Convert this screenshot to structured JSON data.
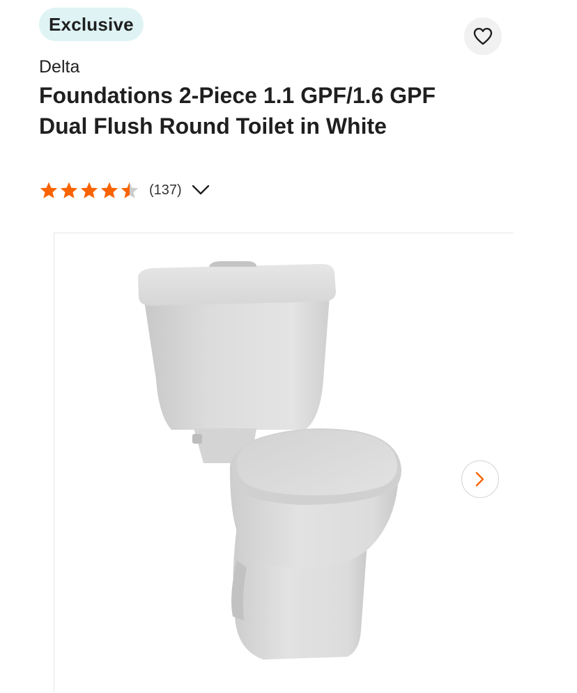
{
  "badge": {
    "label": "Exclusive"
  },
  "brand": "Delta",
  "product_title": "Foundations 2-Piece 1.1 GPF/1.6 GPF Dual Flush Round Toilet in White",
  "rating": {
    "stars": 4.5,
    "max_stars": 5,
    "count_label": "(137)",
    "star_color": "#f96302",
    "empty_star_color": "#cccccc"
  },
  "icons": {
    "favorite": "heart-icon",
    "expand": "chevron-down-icon",
    "next": "chevron-right-icon"
  },
  "colors": {
    "accent": "#f96302",
    "badge_bg": "#dff3f4"
  }
}
